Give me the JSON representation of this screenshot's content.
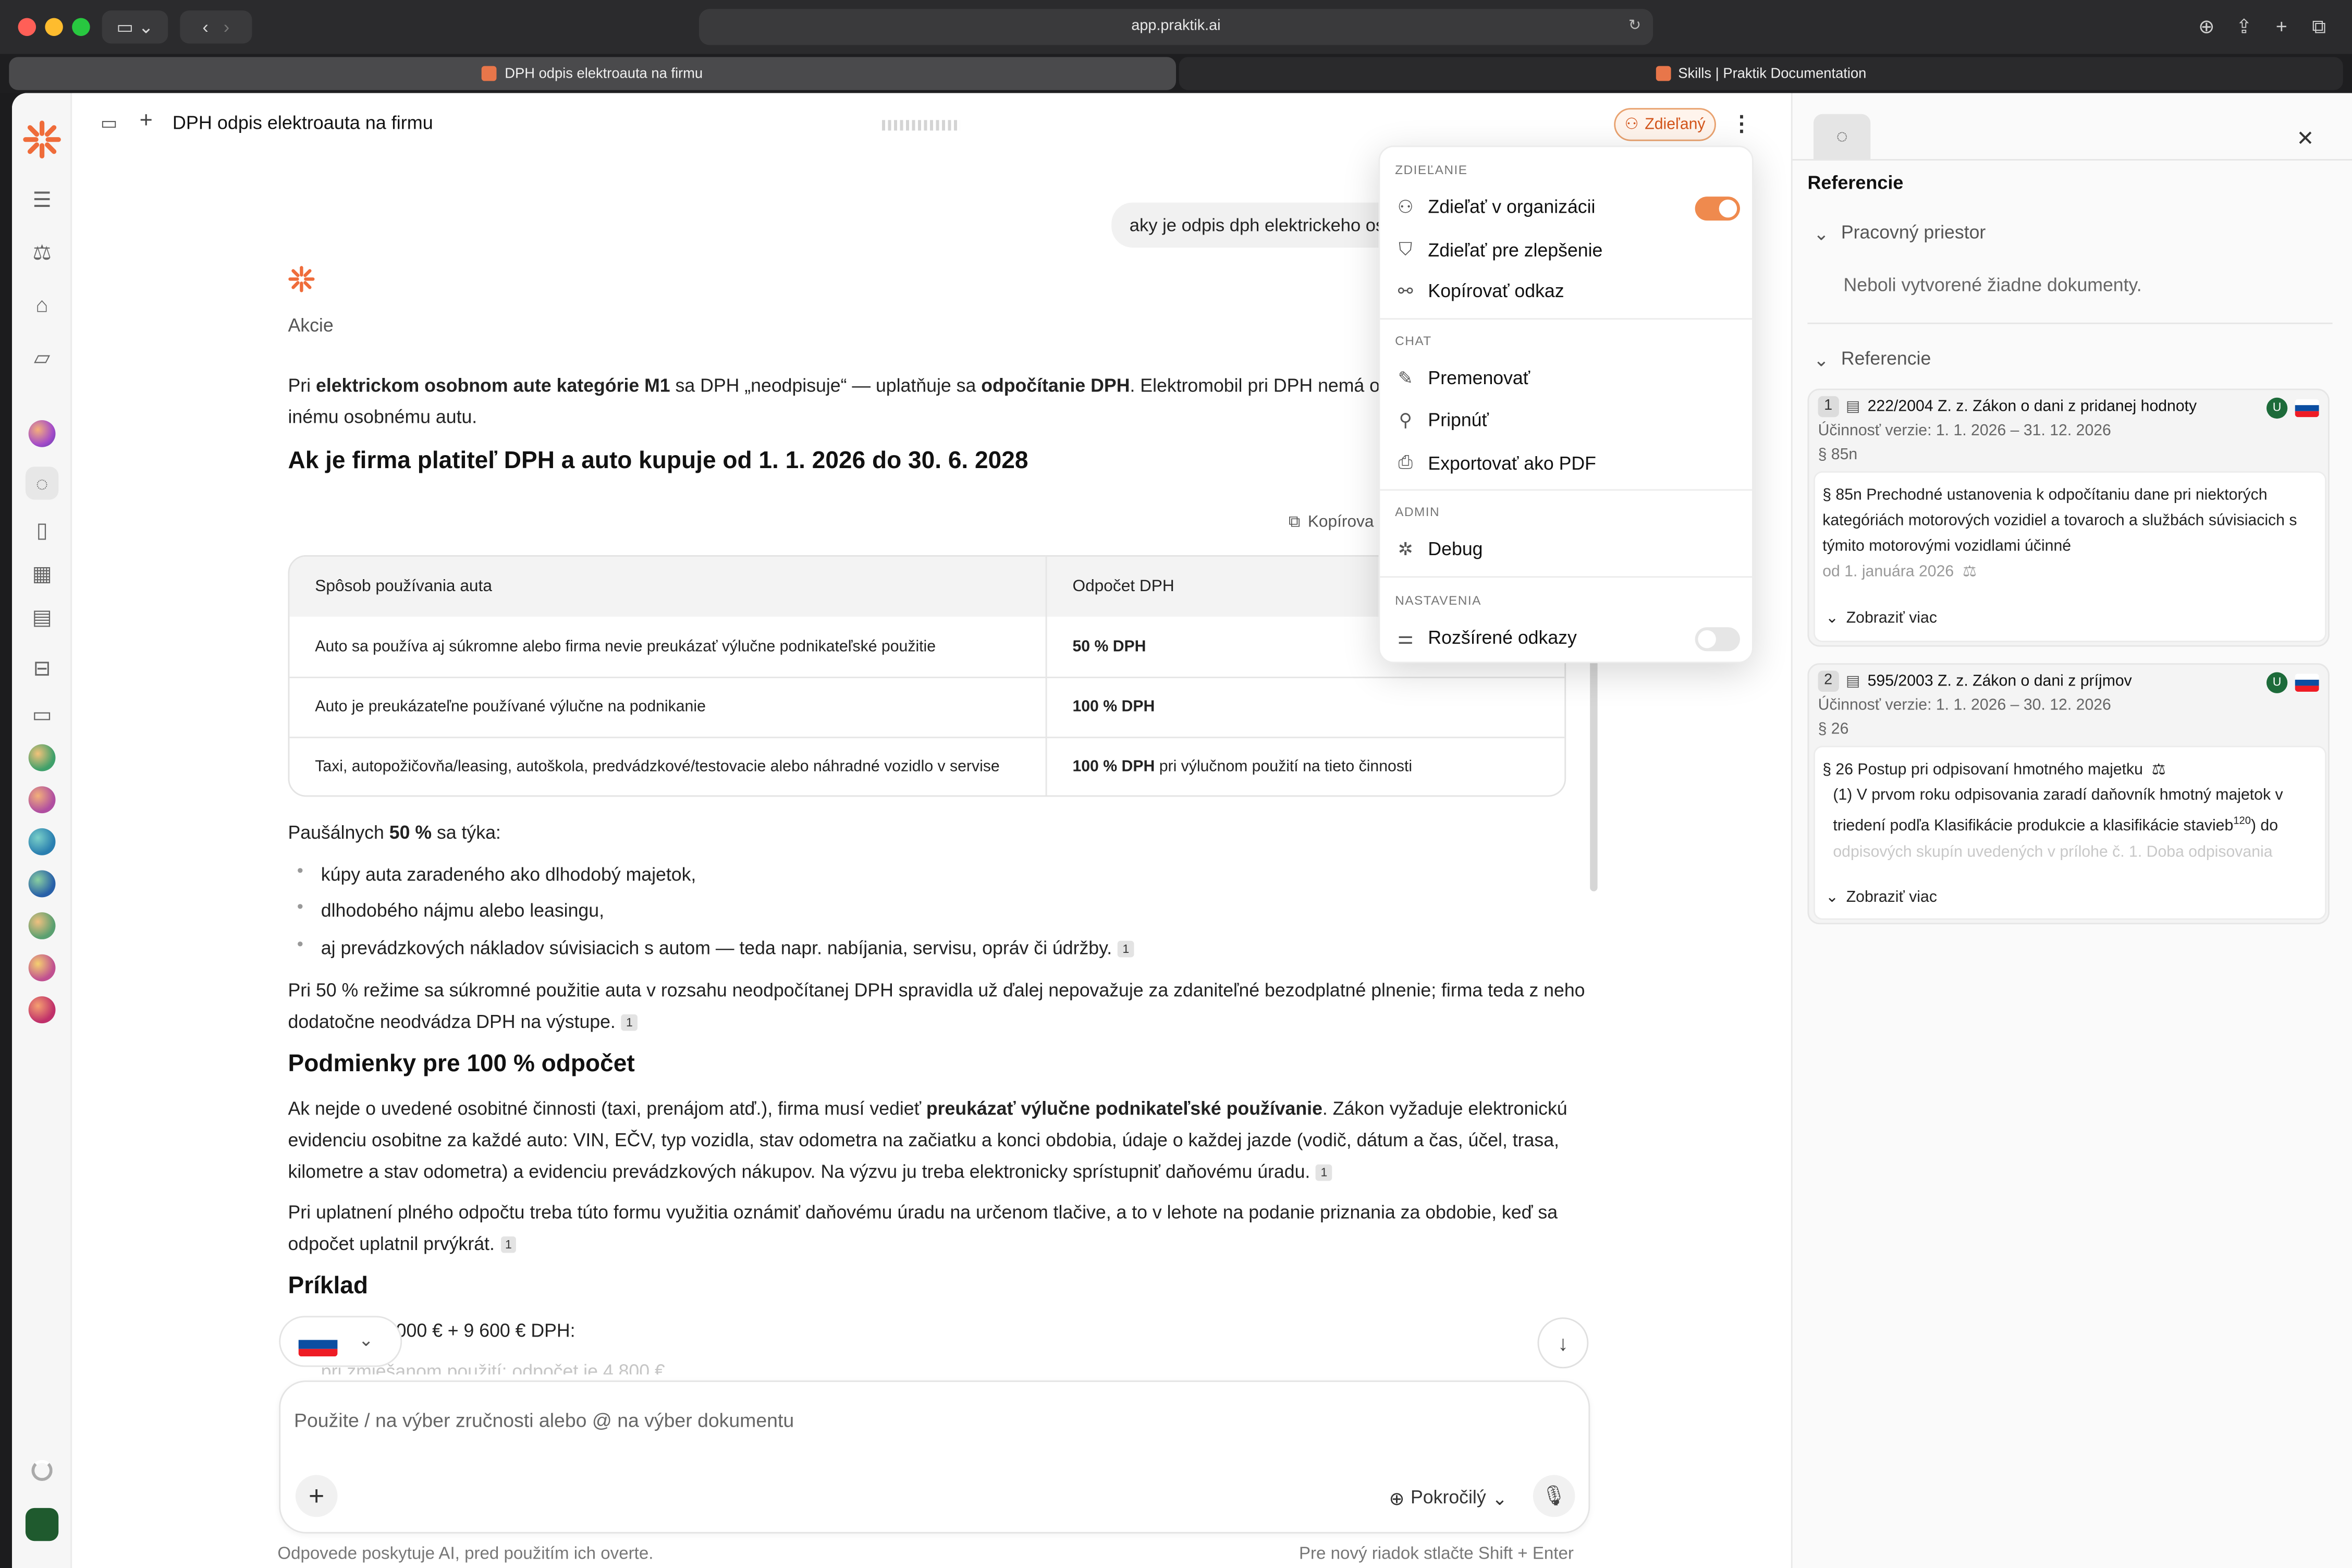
{
  "browser": {
    "url": "app.praktik.ai",
    "tabs": [
      {
        "label": "DPH odpis elektroauta na firmu",
        "active": true
      },
      {
        "label": "Skills | Praktik Documentation",
        "active": false
      }
    ]
  },
  "header": {
    "title": "DPH odpis elektroauta na firmu",
    "share_label": "Zdieľaný"
  },
  "chat": {
    "user_message": "aky je odpis dph elektrickeho os",
    "actions_label": "Akcie",
    "intro_parts": [
      "Pri ",
      "elektrickom osobnom aute kategórie M1",
      " sa DPH „neodpisuje“ — uplatňuje sa ",
      "odpočítanie DPH",
      ". Elektromobil pri DPH nemá osobit"
    ],
    "intro_line2": "inému osobnému autu.",
    "heading1": "Ak je firma platiteľ DPH a auto kupuje od 1. 1. 2026 do 30. 6. 2028",
    "copy_label": "Kopírova",
    "table": {
      "headers": [
        "Spôsob používania auta",
        "Odpočet DPH"
      ],
      "rows": [
        {
          "usage": "Auto sa používa aj súkromne alebo firma nevie preukázať výlučne podnikateľské použitie",
          "deduction": "50 % DPH",
          "suffix": ""
        },
        {
          "usage": "Auto je preukázateľne používané výlučne na podnikanie",
          "deduction": "100 % DPH",
          "suffix": ""
        },
        {
          "usage": "Taxi, autopožičovňa/leasing, autoškola, predvádzkové/testovacie alebo náhradné vozidlo v servise",
          "deduction": "100 % DPH",
          "suffix": " pri výlučnom použití na tieto činnosti"
        }
      ]
    },
    "paus_parts": [
      "Paušálnych ",
      "50 %",
      " sa týka:"
    ],
    "bullets": [
      "kúpy auta zaradeného ako dlhodobý majetok,",
      "dlhodobého nájmu alebo leasingu,",
      "aj prevádzkových nákladov súvisiacich s autom — teda napr. nabíjania, servisu, opráv či údržby."
    ],
    "ref_badge": "1",
    "para50_line1": "Pri 50 % režime sa súkromné použitie auta v rozsahu neodpočítanej DPH spravidla už ďalej nepovažuje za zdaniteľné bezodplatné plnenie; firma teda z neho",
    "para50_line2": "dodatočne neodvádza DPH na výstupe.",
    "heading2": "Podmienky pre 100 % odpočet",
    "cond_l1_parts": [
      "Ak nejde o uvedené osobitné činnosti (taxi, prenájom atď.), firma musí vedieť ",
      "preukázať výlučne podnikateľské používanie",
      ". Zákon vyžaduje elektronickú"
    ],
    "cond_l2": "evidenciu osobitne za každé auto: VIN, EČV, typ vozidla, stav odometra na začiatku a konci obdobia, údaje o každej jazde (vodič, dátum a čas, účel, trasa,",
    "cond_l3": "kilometre a stav odometra) a evidenciu prevádzkových nákupov. Na výzvu ju treba elektronicky sprístupniť daňovému úradu.",
    "apply_l1": "Pri uplatnení plného odpočtu treba túto formu využitia oznámiť daňovému úradu na určenom tlačive, a to v lehote na podanie priznania za obdobie, keď sa",
    "apply_l2": "odpočet uplatnil prvýkrát.",
    "heading3": "Príklad",
    "example_line": "000 € + 9 600 € DPH:",
    "example_faded": "pri zmiešanom použití: odpočet je 4 800 €"
  },
  "composer": {
    "placeholder": "Použite / na výber zručnosti alebo @ na výber dokumentu",
    "mode_label": "Pokročilý",
    "footer_left": "Odpovede poskytuje AI, pred použitím ich overte.",
    "footer_right": "Pre nový riadok stlačte Shift + Enter"
  },
  "menu": {
    "sections": [
      {
        "title": "ZDIEĽANIE",
        "items": [
          {
            "label": "Zdieľať v organizácii",
            "icon": "users-icon"
          },
          {
            "label": "Zdieľať pre zlepšenie",
            "icon": "shield-icon"
          },
          {
            "label": "Kopírovať odkaz",
            "icon": "link-icon"
          }
        ]
      },
      {
        "title": "CHAT",
        "items": [
          {
            "label": "Premenovať",
            "icon": "pencil-icon"
          },
          {
            "label": "Pripnúť",
            "icon": "pin-icon"
          },
          {
            "label": "Exportovať ako PDF",
            "icon": "export-icon"
          }
        ]
      },
      {
        "title": "ADMIN",
        "items": [
          {
            "label": "Debug",
            "icon": "bug-icon"
          }
        ]
      },
      {
        "title": "NASTAVENIA",
        "items": [
          {
            "label": "Rozšírené odkazy",
            "icon": "sliders-icon"
          }
        ]
      }
    ],
    "org_share_on": true,
    "extended_links_on": false,
    "accent": "#ef8a4e"
  },
  "references": {
    "title": "Referencie",
    "workspace_label": "Pracovný priestor",
    "workspace_empty": "Neboli vytvorené žiadne dokumenty.",
    "refs_label": "Referencie",
    "items": [
      {
        "num": "1",
        "title": "222/2004 Z. z. Zákon o dani z pridanej hodnoty",
        "validity": "Účinnosť verzie: 1. 1. 2026 – 31. 12. 2026",
        "section": "§ 85n",
        "body_title_l1": "§ 85n Prechodné ustanovenia k odpočítaniu dane pri niektorých",
        "body_title_l2": "kategóriách motorových vozidiel a tovaroch a službách súvisiacich s",
        "body_title_l3": "týmito motorovými vozidlami účinné",
        "body_faded": "od 1. januára 2026",
        "show_more": "Zobraziť viac",
        "badge": "U"
      },
      {
        "num": "2",
        "title": "595/2003 Z. z. Zákon o dani z príjmov",
        "validity": "Účinnosť verzie: 1. 1. 2026 – 30. 12. 2026",
        "section": "§ 26",
        "body_title_l1": "§ 26 Postup pri odpisovaní hmotného majetku",
        "body_l2": "(1) V prvom roku odpisovania zaradí daňovník hmotný majetok v",
        "body_l3": "triedení podľa Klasifikácie produkcie a klasifikácie stavieb",
        "body_sup": "120",
        "body_l3b": ") do",
        "body_faded": "odpisových skupín uvedených v prílohe č. 1. Doba odpisovania",
        "show_more": "Zobraziť viac",
        "badge": "U"
      }
    ]
  }
}
